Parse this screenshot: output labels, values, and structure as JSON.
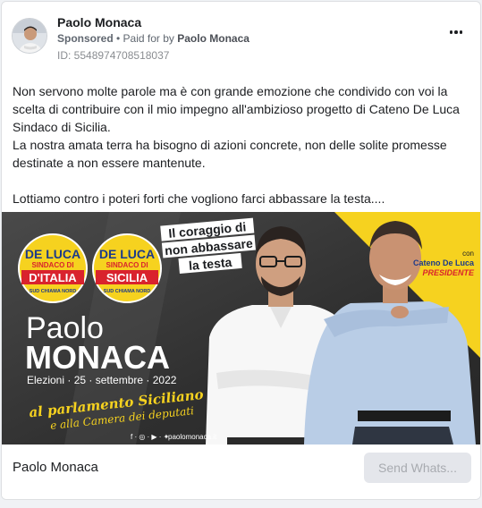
{
  "ad": {
    "page_name": "Paolo Monaca",
    "sponsored": "Sponsored",
    "separator": " • ",
    "paid_for_prefix": "Paid for by ",
    "paid_for_name": "Paolo Monaca",
    "ad_id": "ID: 5548974708518037",
    "more_icon": "more-horizontal-icon"
  },
  "body": {
    "paragraphs": [
      "Non servono molte parole ma è con grande emozione che condivido con voi la scelta di contribuire con il mio impegno all'ambizioso progetto di Cateno De Luca Sindaco di Sicilia.",
      "La nostra amata terra ha bisogno di azioni concrete, non delle solite promesse destinate a non essere mantenute.",
      "Lottiamo contro i poteri forti che vogliono farci abbassare la testa...."
    ]
  },
  "creative": {
    "badge_italia": {
      "line1": "DE LUCA",
      "line2": "SINDACO DI",
      "line3": "D'ITALIA",
      "line4": "SUD CHIAMA NORD"
    },
    "badge_sicilia": {
      "line1": "DE LUCA",
      "line2": "SINDACO DI",
      "line3": "SICILIA",
      "line4": "SUD CHIAMA NORD"
    },
    "slogan": [
      "Il coraggio di",
      "non abbassare",
      "la testa"
    ],
    "first_name": "Paolo",
    "last_name": "MONACA",
    "election": "Elezioni · 25 · settembre · 2022",
    "script_line1": "al parlamento Siciliano",
    "script_line2": "e alla Camera dei deputati",
    "with_label": "con",
    "with_name": "Cateno De Luca",
    "with_role": "PRESIDENTE",
    "social_icons": "f · ◎ · ▶ · ✦",
    "website": "paolomonaca.it",
    "colors": {
      "background": "#3a3a3a",
      "accent_yellow": "#f6d21f",
      "badge_red": "#d9232d"
    }
  },
  "footer": {
    "title": "Paolo Monaca",
    "cta_label": "Send Whats..."
  }
}
